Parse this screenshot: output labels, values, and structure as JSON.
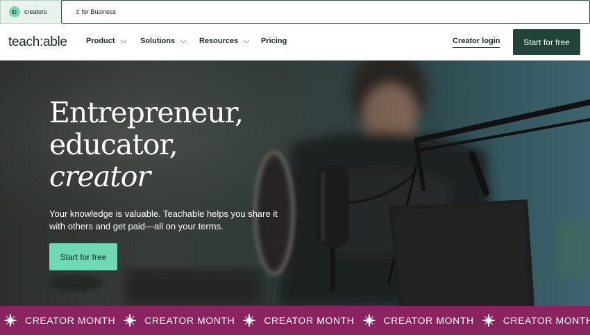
{
  "switcher": {
    "creators_logo": "t:",
    "creators_label": "creators",
    "business_label": "t: for Business"
  },
  "nav": {
    "brand": "teach:able",
    "items": [
      {
        "label": "Product",
        "has_dropdown": true
      },
      {
        "label": "Solutions",
        "has_dropdown": true
      },
      {
        "label": "Resources",
        "has_dropdown": true
      },
      {
        "label": "Pricing",
        "has_dropdown": false
      }
    ],
    "login": "Creator login",
    "cta": "Start for free"
  },
  "hero": {
    "headline_line1": "Entrepreneur,",
    "headline_line2": "educator,",
    "headline_line3": "creator",
    "subtitle": "Your knowledge is valuable. Teachable helps you share it with others and get paid—all on your terms.",
    "cta": "Start for free"
  },
  "marquee": {
    "items": [
      "CREATOR MONTH",
      "CREATOR MONTH",
      "CREATOR MONTH",
      "CREATOR MONTH",
      "CREATOR MONTH"
    ],
    "icon": "sparkle-icon"
  },
  "colors": {
    "brand_dark": "#22433a",
    "accent_mint": "#6fd9b3",
    "marquee_bg": "#8a2460"
  }
}
